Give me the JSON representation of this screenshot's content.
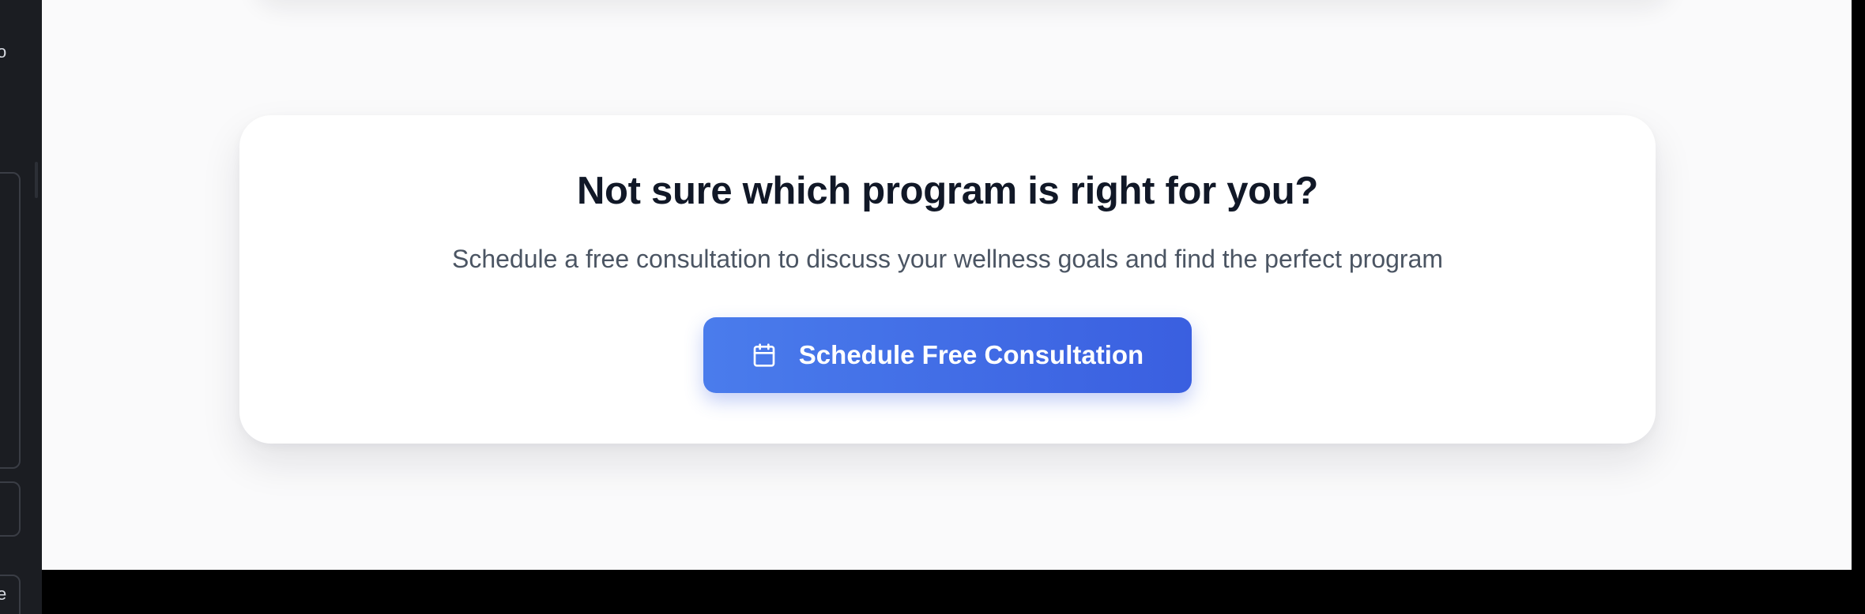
{
  "cta": {
    "title": "Not sure which program is right for you?",
    "subtitle": "Schedule a free consultation to discuss your wellness goals and find the perfect program",
    "button_label": "Schedule Free Consultation",
    "button_icon": "calendar-icon"
  },
  "colors": {
    "accent": "#3a5fe0",
    "title": "#111827",
    "subtitle": "#4b5563"
  }
}
